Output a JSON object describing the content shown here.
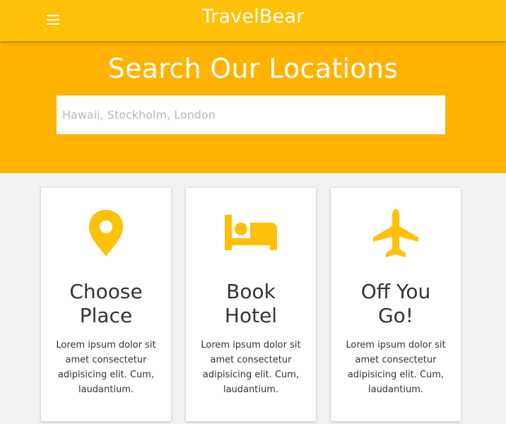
{
  "app": {
    "title": "TravelBear"
  },
  "navbar": {
    "menu_icon": "menu-icon"
  },
  "hero": {
    "title": "Search Our Locations",
    "search_placeholder": "Hawaii, Stockholm, London",
    "search_value": ""
  },
  "cards": [
    {
      "icon": "location-pin-icon",
      "title": "Choose\nPlace",
      "text": "Lorem ipsum dolor sit amet consectetur adipisicing elit. Cum, laudantium."
    },
    {
      "icon": "bed-icon",
      "title": "Book\nHotel",
      "text": "Lorem ipsum dolor sit amet consectetur adipisicing elit. Cum, laudantium."
    },
    {
      "icon": "airplane-icon",
      "title": "Off You\nGo!",
      "text": "Lorem ipsum dolor sit amet consectetur adipisicing elit. Cum, laudantium."
    }
  ],
  "colors": {
    "navbar": "#ffc107",
    "hero": "#ffb300",
    "accent": "#ffc107",
    "background": "#f2f2f2"
  }
}
